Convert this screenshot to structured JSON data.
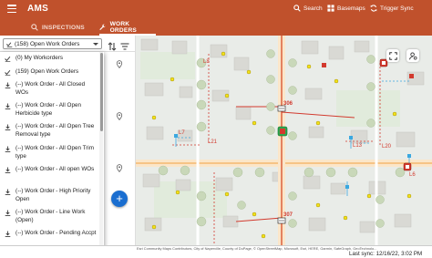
{
  "app": {
    "title": "AMS"
  },
  "header": {
    "search_label": "Search",
    "basemaps_label": "Basemaps",
    "trigger_sync_label": "Trigger Sync"
  },
  "tabs": [
    {
      "label": "INSPECTIONS",
      "active": false
    },
    {
      "label": "WORK ORDERS",
      "active": true
    }
  ],
  "filter": {
    "selected": "(158) Open Work Orders"
  },
  "dropdown": {
    "items": [
      {
        "label": "(0) My Workorders",
        "icon": "check-icon"
      },
      {
        "label": "(159) Open Work Orders",
        "icon": "check-icon"
      },
      {
        "label": "(--) Work Order - All Closed WOs",
        "icon": "download-icon"
      },
      {
        "label": "(--) Work Order - All Open Herbicide type",
        "icon": "download-icon"
      },
      {
        "label": "(--) Work Order - All Open Tree Removal type",
        "icon": "download-icon"
      },
      {
        "label": "(--) Work Order - All Open Trim type",
        "icon": "download-icon"
      },
      {
        "label": "(--) Work Order - All open WOs",
        "icon": "download-icon"
      },
      {
        "label": "(--) Work Order - High Priority Open",
        "icon": "download-icon"
      },
      {
        "label": "(--) Work Order - Line Work (Open)",
        "icon": "download-icon"
      },
      {
        "label": "(--) Work Order - Pending Accpt",
        "icon": "download-icon"
      }
    ]
  },
  "map": {
    "labels": {
      "l8": "L8",
      "l7": "L7",
      "l21": "L21",
      "l13": "L13",
      "l20": "L20",
      "l6": "L6",
      "n306": "306",
      "n307": "307"
    }
  },
  "status": {
    "attribution": "Esri Community Maps Contributors, City of Naperville, County of DuPage, © OpenStreetMap, Microsoft, Esri, HERE, Garmin, SafeGraph, GeoTechnolo...",
    "last_sync": "Last sync: 12/16/22, 3:02 PM"
  },
  "colors": {
    "brand": "#c0512c",
    "accent": "#1a6ed0",
    "line_red": "#d23a2e",
    "asset_yellow": "#f2e21b",
    "road_orange": "#f5b870"
  }
}
